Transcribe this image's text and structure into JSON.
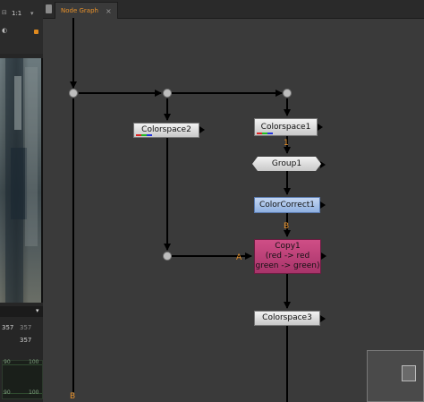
{
  "left_panel": {
    "header_values": [
      "1:1"
    ],
    "readouts": [
      "357",
      "357",
      "357"
    ],
    "graph_ticks": [
      "90",
      "100",
      "90",
      "100"
    ]
  },
  "node_graph": {
    "tab_label": "Node Graph",
    "nodes": {
      "colorspace1": "Colorspace1",
      "colorspace2": "Colorspace2",
      "group1": "Group1",
      "colorcorrect1": "ColorCorrect1",
      "copy1": [
        "Copy1",
        "(red -> red",
        "green -> green)"
      ],
      "colorspace3": "Colorspace3"
    },
    "pins": {
      "a": "A",
      "b_copy": "B",
      "b_bottom": "B",
      "one": "1"
    }
  },
  "colors": {
    "accent": "#e8912a",
    "copy_node": "#b83c76",
    "colorcorrect_node": "#a9c4ee",
    "graph_bg": "#3a3a3a"
  }
}
